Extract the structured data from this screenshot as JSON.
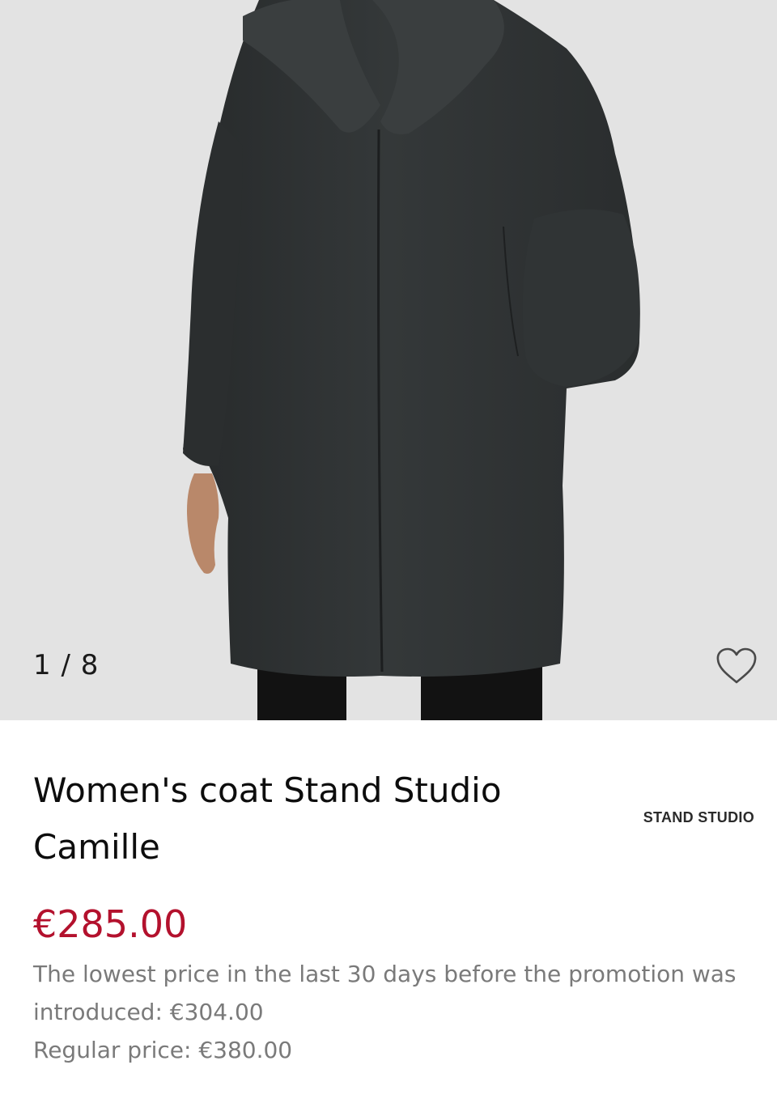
{
  "gallery": {
    "counter": "1 / 8",
    "current_image": 1,
    "total_images": 8,
    "background_color": "#e3e3e3",
    "wishlist_icon": "heart-outline-icon"
  },
  "product": {
    "title": "Women's coat Stand Studio Camille",
    "brand": "STAND STUDIO",
    "price": "€285.00",
    "price_color": "#b3112d",
    "lowest_price_note": "The lowest price in the last 30 days before the promotion was introduced: €304.00",
    "regular_price": "Regular price: €380.00"
  }
}
